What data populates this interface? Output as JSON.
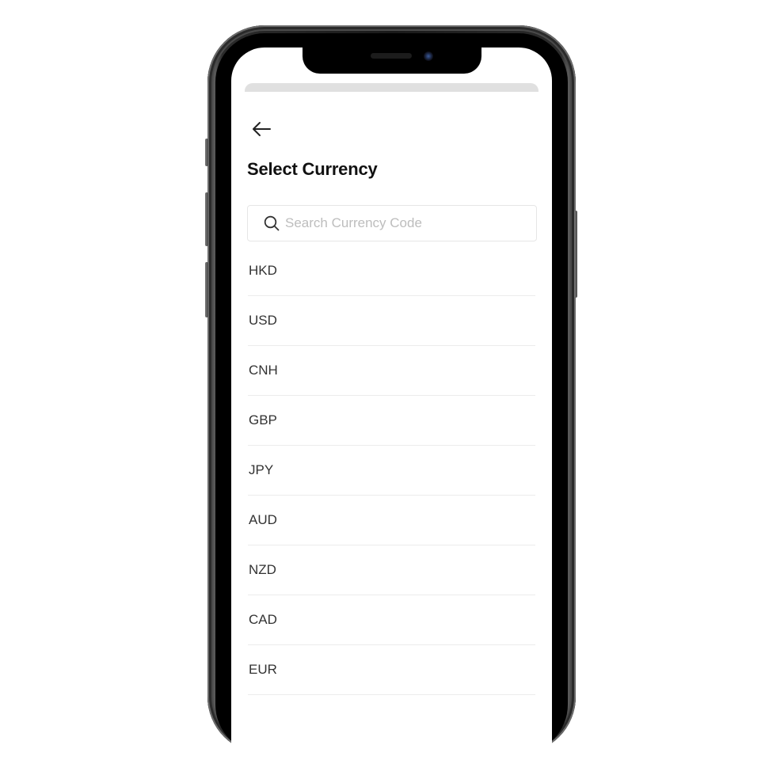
{
  "header": {
    "back_icon": "arrow-left-icon",
    "title": "Select Currency"
  },
  "search": {
    "icon": "search-icon",
    "placeholder": "Search Currency Code",
    "value": ""
  },
  "currencies": [
    {
      "code": "HKD"
    },
    {
      "code": "USD"
    },
    {
      "code": "CNH"
    },
    {
      "code": "GBP"
    },
    {
      "code": "JPY"
    },
    {
      "code": "AUD"
    },
    {
      "code": "NZD"
    },
    {
      "code": "CAD"
    },
    {
      "code": "EUR"
    }
  ],
  "colors": {
    "title": "#111111",
    "text": "#333333",
    "placeholder": "#bdbdbd",
    "divider": "#ececec",
    "search_border": "#e6e6e6",
    "sheet_handle": "#e0e0e0"
  }
}
